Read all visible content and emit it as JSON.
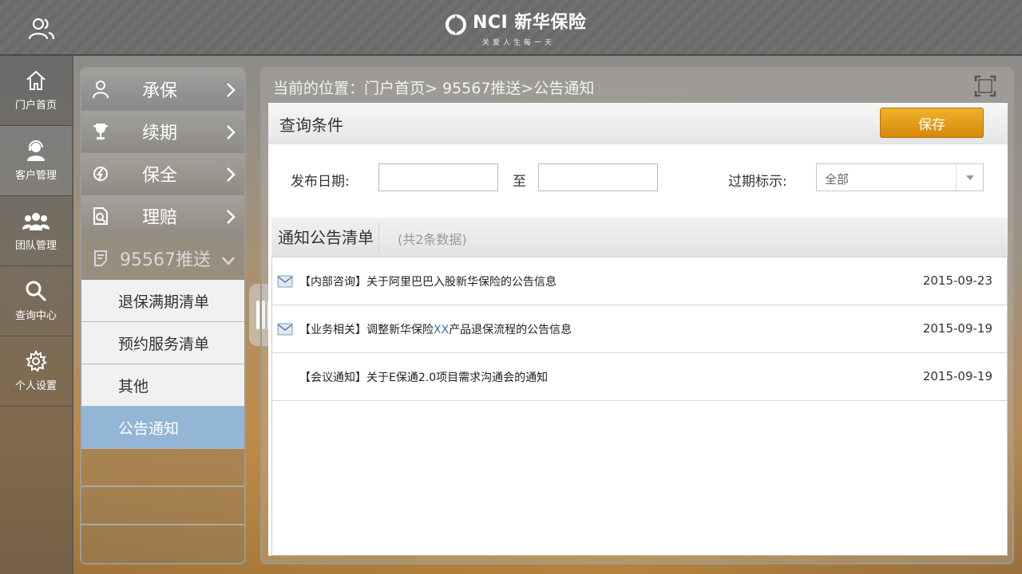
{
  "header": {
    "brand": "NCI 新华保险",
    "slogan": "关爱人生每一天"
  },
  "leftnav": {
    "items": [
      {
        "label": "门户首页",
        "icon": "home-icon"
      },
      {
        "label": "客户管理",
        "icon": "customer-service-icon",
        "active": true
      },
      {
        "label": "团队管理",
        "icon": "team-icon"
      },
      {
        "label": "查询中心",
        "icon": "search-icon"
      },
      {
        "label": "个人设置",
        "icon": "gear-icon"
      }
    ]
  },
  "submenu": {
    "items": [
      {
        "label": "承保",
        "icon": "person-icon"
      },
      {
        "label": "续期",
        "icon": "trophy-icon"
      },
      {
        "label": "保全",
        "icon": "shield-icon"
      },
      {
        "label": "理赔",
        "icon": "document-search-icon"
      }
    ],
    "open": {
      "label": "95567推送",
      "icon": "notepad-icon"
    },
    "subitems": [
      {
        "label": "退保满期清单"
      },
      {
        "label": "预约服务清单"
      },
      {
        "label": "其他"
      },
      {
        "label": "公告通知",
        "active": true
      }
    ]
  },
  "main": {
    "breadcrumb": "当前的位置：门户首页> 95567推送>公告通知",
    "query_title": "查询条件",
    "save_label": "保存",
    "date_label": "发布日期:",
    "to_label": "至",
    "expire_label": "过期标示:",
    "expire_value": "全部",
    "list_title": "通知公告清单",
    "list_count": "(共2条数据)",
    "rows": [
      {
        "prefix": "【内部咨询】关于阿里巴巴入股新华保险的公告信息",
        "highlight": "",
        "suffix": "",
        "date": "2015-09-23",
        "mail": true
      },
      {
        "prefix": "【业务相关】调整新华保险",
        "highlight": "XX",
        "suffix": "产品退保流程的公告信息",
        "date": "2015-09-19",
        "mail": true
      },
      {
        "prefix": "【会议通知】关于E保通2.0项目需求沟通会的通知",
        "highlight": "",
        "suffix": "",
        "date": "2015-09-19",
        "mail": false
      }
    ]
  },
  "colors": {
    "accent_button": "#e09a16",
    "active_subitem": "#93b5d6",
    "highlight_text": "#3a6fb0"
  }
}
